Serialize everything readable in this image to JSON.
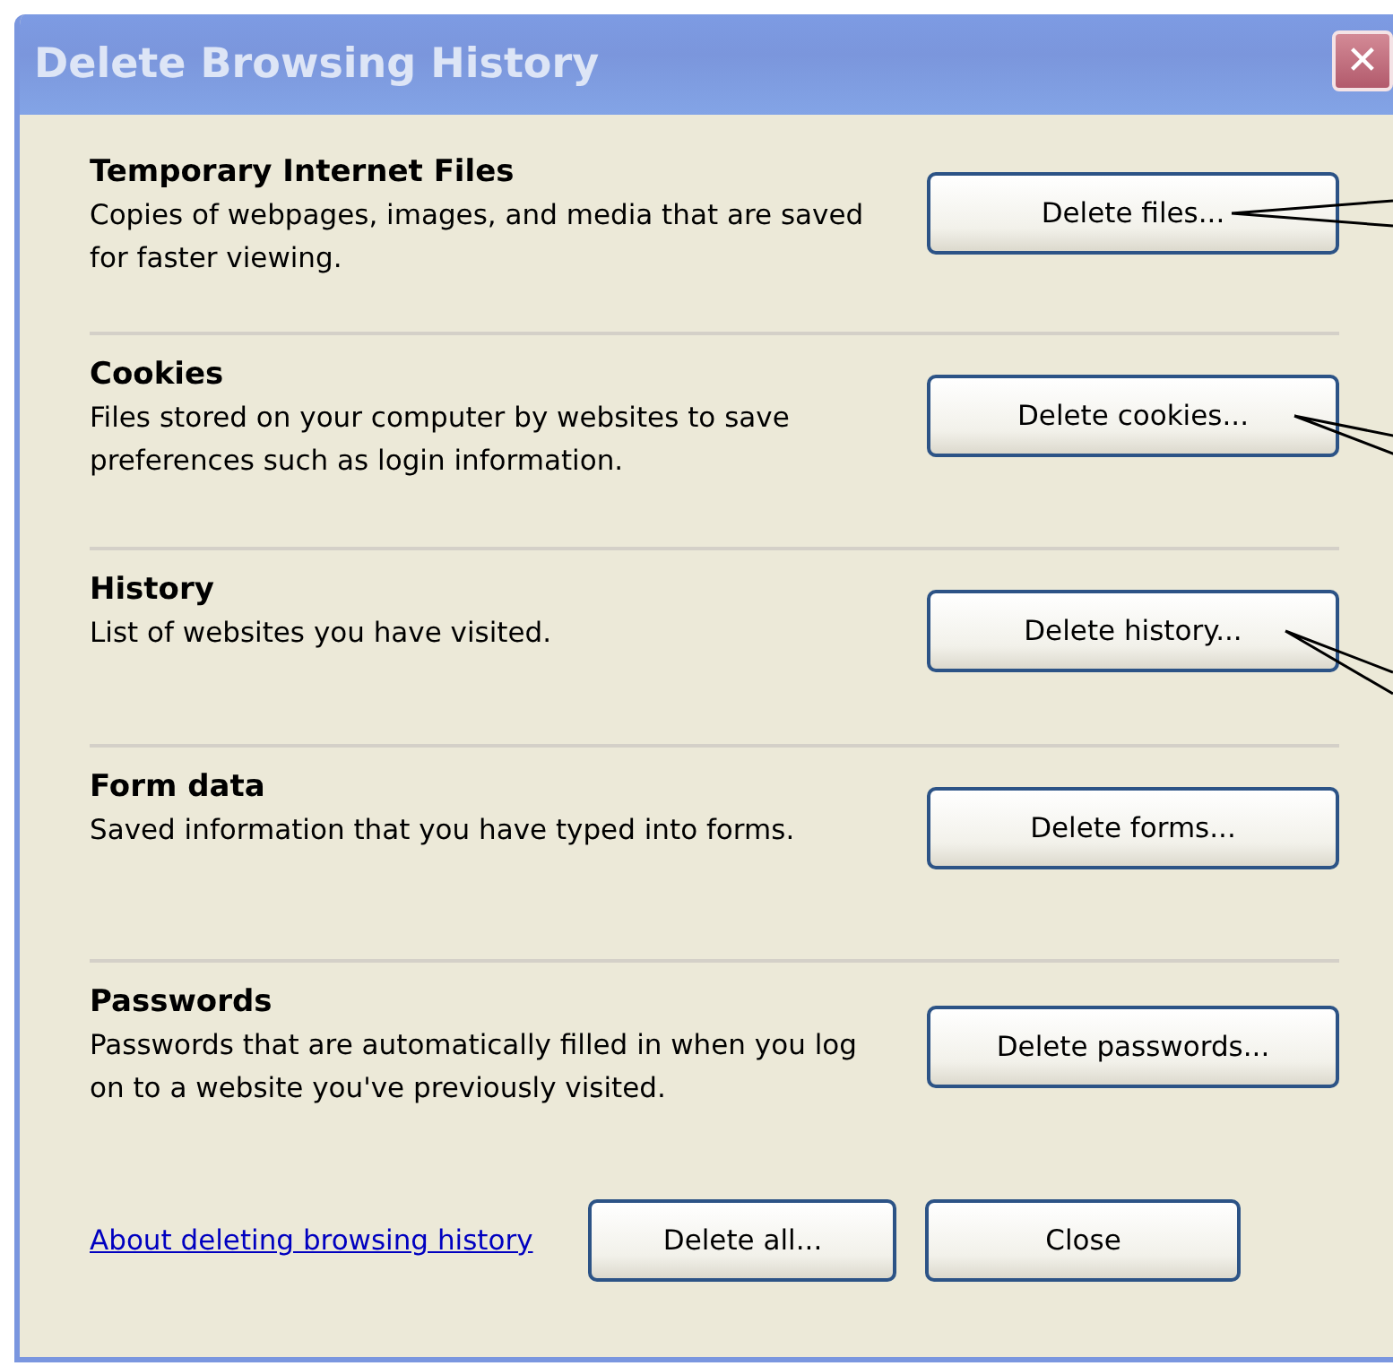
{
  "window": {
    "title": "Delete Browsing History",
    "close_symbol": "✕"
  },
  "sections": [
    {
      "title": "Temporary Internet Files",
      "description": "Copies of webpages, images, and media that are saved for faster viewing.",
      "button": "Delete files..."
    },
    {
      "title": "Cookies",
      "description": "Files stored on your computer by websites to save preferences such as login information.",
      "button": "Delete cookies..."
    },
    {
      "title": "History",
      "description": "List of websites you have visited.",
      "button": "Delete history..."
    },
    {
      "title": "Form data",
      "description": "Saved information that you have typed into forms.",
      "button": "Delete forms..."
    },
    {
      "title": "Passwords",
      "description": "Passwords that are automatically filled in when you log on to a website you've previously visited.",
      "button": "Delete passwords..."
    }
  ],
  "footer": {
    "link": "About deleting browsing history",
    "buttons": [
      "Delete all...",
      "Close"
    ]
  }
}
